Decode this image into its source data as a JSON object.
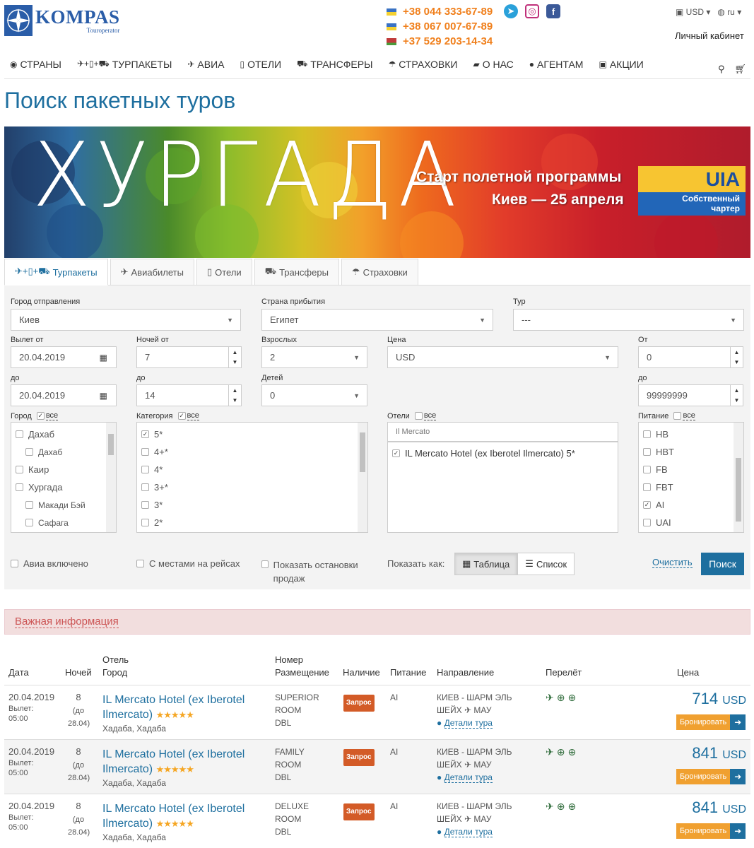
{
  "brand": {
    "name": "KOMPAS",
    "sub": "Touroperator"
  },
  "phones": [
    "+38 044 333-67-89",
    "+38 067 007-67-89",
    "+37 529 203-14-34"
  ],
  "currency": "USD",
  "language": "ru",
  "cabinet": "Личный кабинет",
  "nav": [
    {
      "icon": "globe-icon",
      "label": "СТРАНЫ"
    },
    {
      "icon": "package-icon",
      "label": "ТУРПАКЕТЫ"
    },
    {
      "icon": "plane-icon",
      "label": "АВИА"
    },
    {
      "icon": "building-icon",
      "label": "ОТЕЛИ"
    },
    {
      "icon": "car-icon",
      "label": "ТРАНСФЕРЫ"
    },
    {
      "icon": "umbrella-icon",
      "label": "СТРАХОВКИ"
    },
    {
      "icon": "book-icon",
      "label": "О НАС"
    },
    {
      "icon": "user-icon",
      "label": "АГЕНТАМ"
    },
    {
      "icon": "gift-icon",
      "label": "АКЦИИ"
    }
  ],
  "page_title": "Поиск пакетных туров",
  "banner": {
    "headline": "ХУРГАДА",
    "line1": "Старт полетной программы",
    "line2": "Киев — 25 апреля",
    "uia_logo": "UIA",
    "uia_text1": "Собственный",
    "uia_text2": "чартер"
  },
  "tabs": [
    {
      "label": "Турпакеты",
      "active": true
    },
    {
      "label": "Авиабилеты"
    },
    {
      "label": "Отели"
    },
    {
      "label": "Трансферы"
    },
    {
      "label": "Страховки"
    }
  ],
  "form": {
    "departure_city_label": "Город отправления",
    "departure_city": "Киев",
    "arrival_country_label": "Страна прибытия",
    "arrival_country": "Египет",
    "tour_label": "Тур",
    "tour": "---",
    "date_from_label": "Вылет от",
    "date_from": "20.04.2019",
    "date_to_label": "до",
    "date_to": "20.04.2019",
    "nights_from_label": "Ночей от",
    "nights_from": "7",
    "nights_to_label": "до",
    "nights_to": "14",
    "adults_label": "Взрослых",
    "adults": "2",
    "children_label": "Детей",
    "children": "0",
    "price_label": "Цена",
    "price_currency": "USD",
    "price_from_label": "От",
    "price_from": "0",
    "price_to_label": "до",
    "price_to": "99999999",
    "city_label": "Город",
    "all": "все",
    "cities": [
      {
        "name": "Дахаб",
        "indent": false,
        "checked": false
      },
      {
        "name": "Дахаб",
        "indent": true,
        "checked": false
      },
      {
        "name": "Каир",
        "indent": false,
        "checked": false
      },
      {
        "name": "Хургада",
        "indent": false,
        "checked": false
      },
      {
        "name": "Макади Бэй",
        "indent": true,
        "checked": false
      },
      {
        "name": "Сафага",
        "indent": true,
        "checked": false
      }
    ],
    "category_label": "Категория",
    "categories": [
      {
        "name": "5*",
        "checked": true
      },
      {
        "name": "4+*",
        "checked": false
      },
      {
        "name": "4*",
        "checked": false
      },
      {
        "name": "3+*",
        "checked": false
      },
      {
        "name": "3*",
        "checked": false
      },
      {
        "name": "2*",
        "checked": false
      }
    ],
    "hotels_label": "Отели",
    "hotel_search": "Il Mercato",
    "hotels": [
      {
        "name": "IL Mercato Hotel (ex Iberotel Ilmercato) 5*",
        "checked": true
      }
    ],
    "meal_label": "Питание",
    "meals": [
      {
        "name": "HB",
        "checked": false
      },
      {
        "name": "HBT",
        "checked": false
      },
      {
        "name": "FB",
        "checked": false
      },
      {
        "name": "FBT",
        "checked": false
      },
      {
        "name": "AI",
        "checked": true
      },
      {
        "name": "UAI",
        "checked": false
      }
    ],
    "avia_included": "Авиа включено",
    "with_seats": "С местами на рейсах",
    "show_stops": "Показать остановки продаж",
    "show_as": "Показать как:",
    "view_table": "Таблица",
    "view_list": "Список",
    "clear": "Очистить",
    "search": "Поиск"
  },
  "important": "Важная информация",
  "table": {
    "headers": {
      "date": "Дата",
      "nights": "Ночей",
      "hotel1": "Отель",
      "hotel2": "Город",
      "room1": "Номер",
      "room2": "Размещение",
      "avail": "Наличие",
      "meal": "Питание",
      "dir": "Направление",
      "flight": "Перелёт",
      "price": "Цена"
    },
    "rows": [
      {
        "date": "20.04.2019",
        "dep_label": "Вылет:",
        "dep_time": "05:00",
        "nights": "8",
        "nights_to": "(до",
        "nights_date": "28.04)",
        "hotel1": "IL Mercato Hotel (ex Iberotel",
        "hotel2": "Ilmercato)",
        "stars": "★★★★★",
        "city": "Хадаба, Хадаба",
        "room1": "SUPERIOR",
        "room2": "ROOM",
        "room3": "DBL",
        "avail": "Запрос",
        "meal": "AI",
        "dir1": "КИЕВ - ШАРМ ЭЛЬ",
        "dir2a": "ШЕЙХ",
        "dir2b": "МАУ",
        "detail": "Детали тура",
        "price": "714",
        "cur": "USD",
        "book": "Бронировать"
      },
      {
        "date": "20.04.2019",
        "dep_label": "Вылет:",
        "dep_time": "05:00",
        "nights": "8",
        "nights_to": "(до",
        "nights_date": "28.04)",
        "hotel1": "IL Mercato Hotel (ex Iberotel",
        "hotel2": "Ilmercato)",
        "stars": "★★★★★",
        "city": "Хадаба, Хадаба",
        "room1": "FAMILY",
        "room2": "ROOM",
        "room3": "DBL",
        "avail": "Запрос",
        "meal": "AI",
        "dir1": "КИЕВ - ШАРМ ЭЛЬ",
        "dir2a": "ШЕЙХ",
        "dir2b": "МАУ",
        "detail": "Детали тура",
        "price": "841",
        "cur": "USD",
        "book": "Бронировать"
      },
      {
        "date": "20.04.2019",
        "dep_label": "Вылет:",
        "dep_time": "05:00",
        "nights": "8",
        "nights_to": "(до",
        "nights_date": "28.04)",
        "hotel1": "IL Mercato Hotel (ex Iberotel",
        "hotel2": "Ilmercato)",
        "stars": "★★★★★",
        "city": "Хадаба, Хадаба",
        "room1": "DELUXE",
        "room2": "ROOM",
        "room3": "DBL",
        "avail": "Запрос",
        "meal": "AI",
        "dir1": "КИЕВ - ШАРМ ЭЛЬ",
        "dir2a": "ШЕЙХ",
        "dir2b": "МАУ",
        "detail": "Детали тура",
        "price": "841",
        "cur": "USD",
        "book": "Бронировать"
      }
    ]
  }
}
